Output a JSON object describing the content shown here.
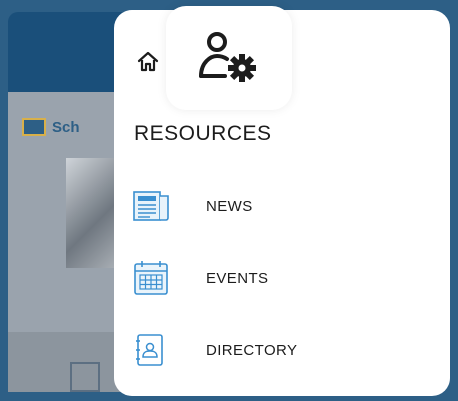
{
  "background": {
    "logo_text": "Sch"
  },
  "drawer": {
    "home_icon": "home-icon",
    "profile_icon": "user-settings-icon",
    "section_title": "RESOURCES",
    "items": [
      {
        "label": "NEWS",
        "icon": "newspaper-icon"
      },
      {
        "label": "EVENTS",
        "icon": "calendar-icon"
      },
      {
        "label": "DIRECTORY",
        "icon": "contact-book-icon"
      }
    ]
  },
  "colors": {
    "icon_accent": "#3a8fd0",
    "text": "#1c1c1c",
    "backdrop": "#2d5f86"
  }
}
